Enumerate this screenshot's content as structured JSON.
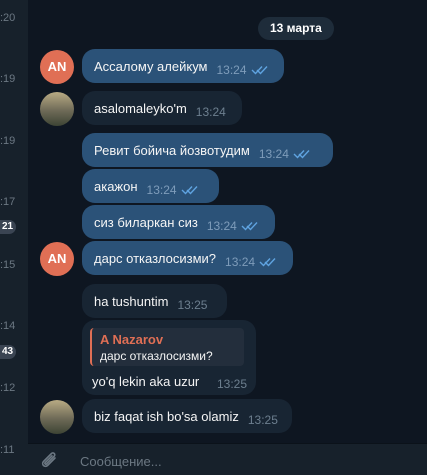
{
  "sidebar": {
    "times": [
      ":20",
      ":19",
      ":19",
      ":17",
      ":15",
      ":14",
      ":12",
      ":11"
    ],
    "badges": [
      "21",
      "43"
    ]
  },
  "chat": {
    "date_label": "13 марта",
    "avatar_initials": "AN",
    "messages": [
      {
        "text": "Ассалому алейкум",
        "time": "13:24"
      },
      {
        "text": "asalomaleyko'm",
        "time": "13:24"
      },
      {
        "text": "Ревит бойича йозвотудим",
        "time": "13:24"
      },
      {
        "text": "акажон",
        "time": "13:24"
      },
      {
        "text": "сиз биларкан сиз",
        "time": "13:24"
      },
      {
        "text": "дарс отказлосизми?",
        "time": "13:24"
      },
      {
        "text": "ha tushuntim",
        "time": "13:25"
      },
      {
        "text": "yo'q lekin aka uzur",
        "time": "13:25"
      },
      {
        "text": "biz faqat ish bo'sa olamiz",
        "time": "13:25"
      }
    ],
    "reply": {
      "name": "A Nazarov",
      "text": "дарс отказлосизми?"
    }
  },
  "composer": {
    "placeholder": "Сообщение..."
  },
  "colors": {
    "background": "#0e1621",
    "outgoing_bubble": "#2b5278",
    "incoming_bubble": "#182533",
    "accent": "#e06f55",
    "read_ticks": "#5fa3e0"
  }
}
